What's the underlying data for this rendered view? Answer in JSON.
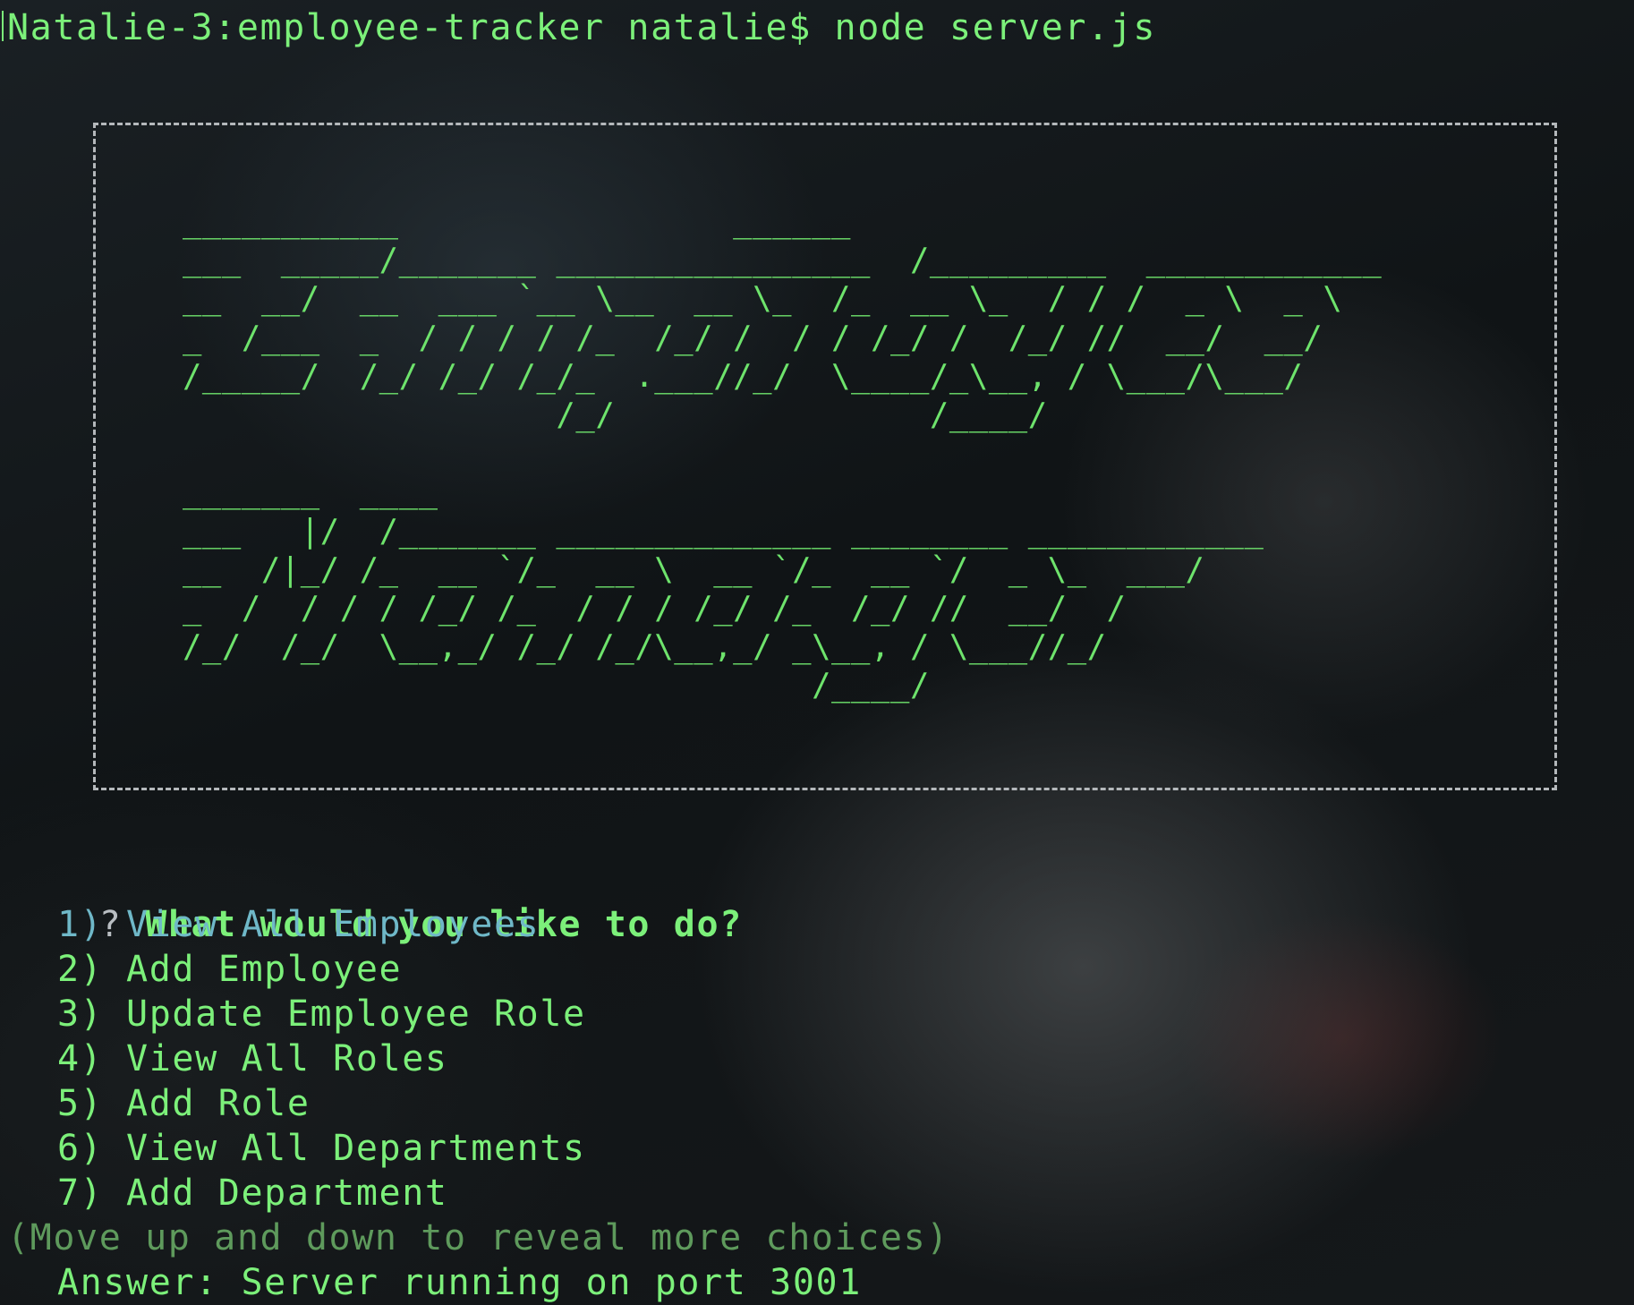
{
  "terminal": {
    "command_line": "Natalie-3:employee-tracker natalie$ node server.js",
    "banner_ascii": "  ___________                 ______\n  ___  _____/_______ ________________  /_________  ____________\n  __  __/  __  ___ `__ \\__  __ \\_  /_  __ \\_  / / /  _ \\  _ \\\n  _  /___  _  / / / / /_  /_/ /  / / /_/ /  /_/ //  __/  __/\n  /_____/  /_/ /_/ /_/_  .___//_/  \\____/_\\__, / \\___/\\___/\n                     /_/                /____/\n\n  _______  ____\n  ___   |/  /_______ ______________ ________ ____________\n  __  /|_/ /_  __ `/_  __ \\  __ `/_  __ `/  _ \\_  ___/\n  _  /  / / / /_/ /_  / / / /_/ /_  /_/ //  __/  /\n  /_/  /_/  \\__,_/ /_/ /_/\\__,_/ _\\__, / \\___//_/\n                                  /____/",
    "prompt": {
      "marker": "?",
      "question": "What would you like to do?"
    },
    "choices": [
      "1) View All Employees",
      "2) Add Employee",
      "3) Update Employee Role",
      "4) View All Roles",
      "5) Add Role",
      "6) View All Departments",
      "7) Add Department"
    ],
    "hint": "(Move up and down to reveal more choices)",
    "answer_line": "Answer: Server running on port 3001"
  },
  "colors": {
    "text_green": "#7cf07a",
    "selected_choice": "#6fb8c8",
    "hint_dim": "#5e9a5c",
    "frame": "#b4b8bb"
  }
}
